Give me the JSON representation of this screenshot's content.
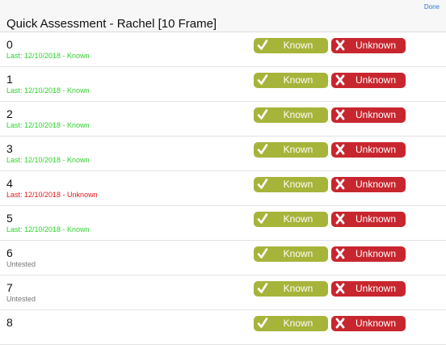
{
  "header": {
    "done_label": "Done",
    "title": "Quick Assessment - Rachel [10 Frame]"
  },
  "buttons": {
    "known_label": "Known",
    "unknown_label": "Unknown"
  },
  "colors": {
    "known_green": "#a6b43a",
    "unknown_red": "#c8262e",
    "status_known": "#2fd32f",
    "status_unknown": "#e01818",
    "status_untested": "#777777"
  },
  "rows": [
    {
      "number": "0",
      "status": "Last: 12/10/2018 - Known",
      "state": "known"
    },
    {
      "number": "1",
      "status": "Last: 12/10/2018 - Known",
      "state": "known"
    },
    {
      "number": "2",
      "status": "Last: 12/10/2018 - Known",
      "state": "known"
    },
    {
      "number": "3",
      "status": "Last: 12/10/2018 - Known",
      "state": "known"
    },
    {
      "number": "4",
      "status": "Last: 12/10/2018 - Unknown",
      "state": "unknown"
    },
    {
      "number": "5",
      "status": "Last: 12/10/2018 - Known",
      "state": "known"
    },
    {
      "number": "6",
      "status": "Untested",
      "state": "untested"
    },
    {
      "number": "7",
      "status": "Untested",
      "state": "untested"
    },
    {
      "number": "8",
      "status": "",
      "state": "untested"
    }
  ]
}
